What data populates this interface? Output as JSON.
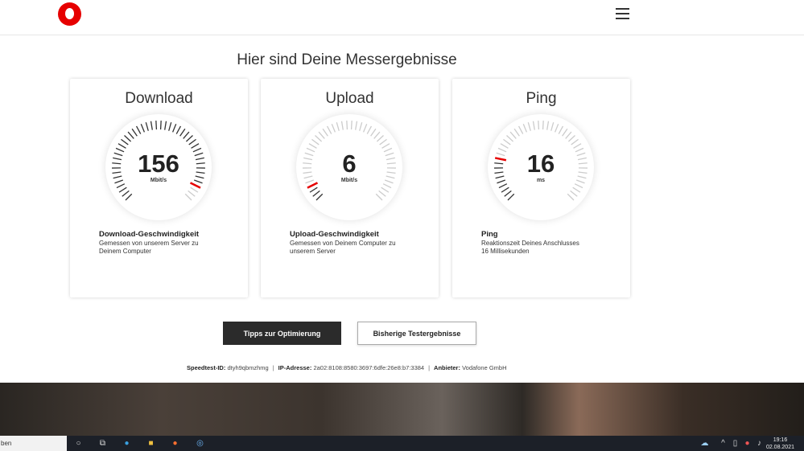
{
  "header": {
    "menu_icon": "hamburger-icon"
  },
  "title": "Hier sind Deine Messergebnisse",
  "cards": [
    {
      "title": "Download",
      "value": "156",
      "unit": "Mbit/s",
      "fraction": 0.93,
      "heading": "Download-Geschwindigkeit",
      "line1": "Gemessen von unserem Server zu",
      "line2": "Deinem Computer"
    },
    {
      "title": "Upload",
      "value": "6",
      "unit": "Mbit/s",
      "fraction": 0.06,
      "heading": "Upload-Geschwindigkeit",
      "line1": "Gemessen von Deinem Computer zu",
      "line2": "unserem Server"
    },
    {
      "title": "Ping",
      "value": "16",
      "unit": "ms",
      "fraction": 0.2,
      "heading": "Ping",
      "line1": "Reaktionszeit Deines Anschlusses",
      "line2": "16 Millisekunden"
    }
  ],
  "buttons": {
    "tips": "Tipps zur Optimierung",
    "history": "Bisherige Testergebnisse"
  },
  "info": {
    "id_label": "Speedtest-ID:",
    "id": "dtyh9qbmzhmg",
    "ip_label": "IP-Adresse:",
    "ip": "2a02:8108:8580:3697:6dfe:26e8:b7:3384",
    "provider_label": "Anbieter:",
    "provider": "Vodafone GmbH"
  },
  "taskbar": {
    "search": "ben",
    "time": "19:16",
    "date": "02.08.2021"
  },
  "colors": {
    "accent": "#e60000",
    "dark": "#2b2b2b"
  }
}
